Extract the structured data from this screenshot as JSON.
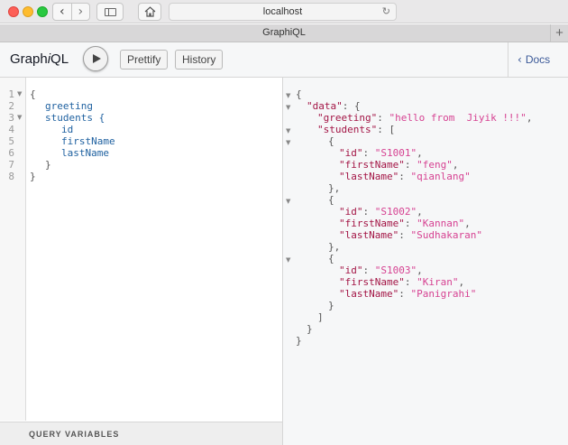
{
  "browser": {
    "address": "localhost",
    "tab_title": "GraphiQL"
  },
  "toolbar": {
    "logo_prefix": "Graph",
    "logo_italic": "i",
    "logo_suffix": "QL",
    "prettify_label": "Prettify",
    "history_label": "History",
    "docs_label": "Docs"
  },
  "query_editor": {
    "line_numbers": [
      "1",
      "2",
      "3",
      "4",
      "5",
      "6",
      "7",
      "8"
    ],
    "lines": [
      {
        "text": "{"
      },
      {
        "text": "greeting"
      },
      {
        "text": "students {"
      },
      {
        "text": "id"
      },
      {
        "text": "firstName"
      },
      {
        "text": "lastName"
      },
      {
        "text": "}"
      },
      {
        "text": "}"
      }
    ],
    "variables_label": "QUERY VARIABLES"
  },
  "result": {
    "open_brace": "{",
    "data_key": "\"data\"",
    "greeting_key": "\"greeting\"",
    "greeting_value": "\"hello from  Jiyik !!!\"",
    "students_key": "\"students\"",
    "students": [
      {
        "id": "\"S1001\"",
        "firstName": "\"feng\"",
        "lastName": "\"qianlang\""
      },
      {
        "id": "\"S1002\"",
        "firstName": "\"Kannan\"",
        "lastName": "\"Sudhakaran\""
      },
      {
        "id": "\"S1003\"",
        "firstName": "\"Kiran\"",
        "lastName": "\"Panigrahi\""
      }
    ],
    "id_key": "\"id\"",
    "first_name_key": "\"firstName\"",
    "last_name_key": "\"lastName\""
  },
  "colors": {
    "field": "#1f61a0",
    "key": "#a31545",
    "string": "#d64292",
    "docs_link": "#3b5998"
  }
}
